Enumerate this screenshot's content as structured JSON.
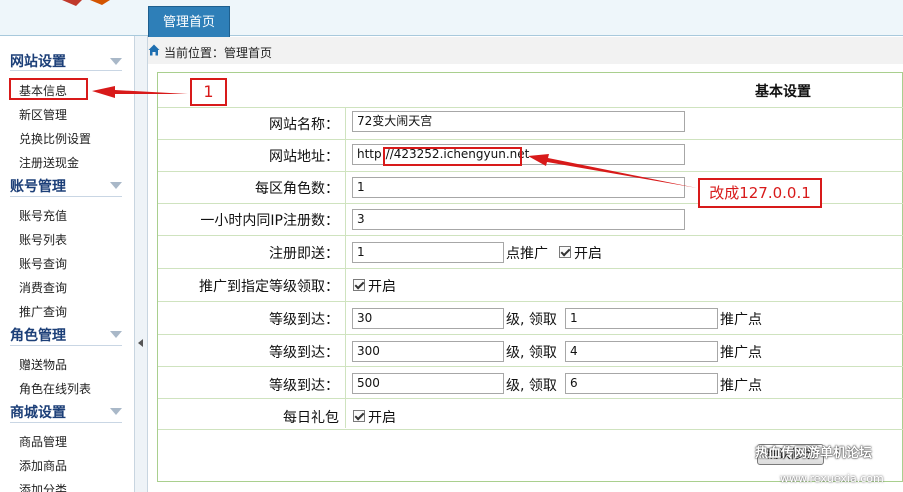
{
  "top_tab": "管理首页",
  "breadcrumb": "当前位置：管理首页",
  "sidebar": {
    "groups": [
      {
        "title": "网站设置",
        "items": [
          "基本信息",
          "新区管理",
          "兑换比例设置",
          "注册送现金"
        ]
      },
      {
        "title": "账号管理",
        "items": [
          "账号充值",
          "账号列表",
          "账号查询",
          "消费查询",
          "推广查询"
        ]
      },
      {
        "title": "角色管理",
        "items": [
          "赠送物品",
          "角色在线列表"
        ]
      },
      {
        "title": "商城设置",
        "items": [
          "商品管理",
          "添加商品",
          "添加分类"
        ]
      }
    ]
  },
  "form": {
    "title": "基本设置",
    "site_name_label": "网站名称：",
    "site_name_value": "72变大闹天宫",
    "site_url_label": "网站地址：",
    "site_url_value": "http://423252.ichengyun.net",
    "roles_per_zone_label": "每区角色数：",
    "roles_per_zone_value": "1",
    "ip_limit_label": "一小时内同IP注册数：",
    "ip_limit_value": "3",
    "register_label": "注册即送：",
    "register_value": "1",
    "register_unit": "点推广",
    "enable_label": "开启",
    "promo_level_label": "推广到指定等级领取：",
    "level_label": "等级到达：",
    "level_mid": "级, 领取",
    "level_unit": "推广点",
    "levels": [
      {
        "level": "30",
        "reward": "1"
      },
      {
        "level": "300",
        "reward": "4"
      },
      {
        "level": "500",
        "reward": "6"
      }
    ],
    "daily_gift_label": "每日礼包",
    "submit_label": "确认修改"
  },
  "annotations": {
    "step_number": "1",
    "note": "改成127.0.0.1"
  },
  "watermark": {
    "line1": "热血传网游单机论坛",
    "line2": "www.rexuexia.com"
  },
  "colors": {
    "accent_tab": "#2e7fb8",
    "annotation": "#d81a1a",
    "table_border": "#a9cf8e",
    "sidebar_group": "#1c3f78"
  }
}
